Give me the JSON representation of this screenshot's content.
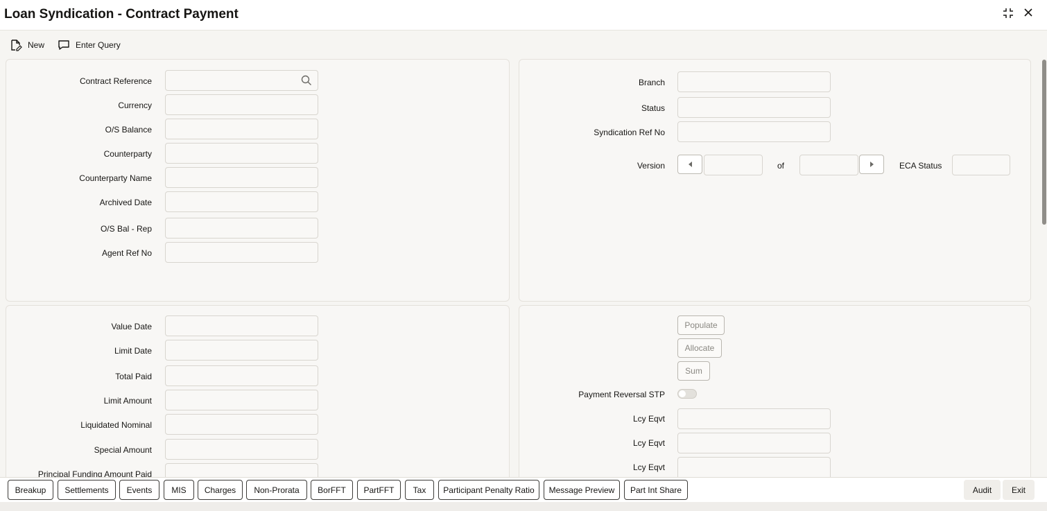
{
  "title": "Loan Syndication - Contract Payment",
  "window_icons": {
    "maximize": "expand-icon",
    "close": "close-icon"
  },
  "toolbar": {
    "new_label": "New",
    "enter_query_label": "Enter Query"
  },
  "header_left": {
    "contract_reference": "Contract Reference",
    "currency": "Currency",
    "os_balance": "O/S Balance",
    "counterparty": "Counterparty",
    "counterparty_name": "Counterparty Name",
    "archived_date": "Archived Date",
    "os_bal_rep": "O/S Bal - Rep",
    "agent_ref_no": "Agent Ref No"
  },
  "header_right": {
    "branch": "Branch",
    "status": "Status",
    "syndication_ref_no": "Syndication Ref No",
    "version": "Version",
    "of": "of",
    "eca_status": "ECA Status"
  },
  "details_left": {
    "value_date": "Value Date",
    "limit_date": "Limit Date",
    "total_paid": "Total Paid",
    "limit_amount": "Limit Amount",
    "liquidated_nominal": "Liquidated Nominal",
    "special_amount": "Special Amount",
    "principal_funding_amount_paid": "Principal Funding Amount Paid"
  },
  "details_right": {
    "populate": "Populate",
    "allocate": "Allocate",
    "sum": "Sum",
    "payment_reversal_stp": "Payment Reversal STP",
    "lcy_eqvt_1": "Lcy Eqvt",
    "lcy_eqvt_2": "Lcy Eqvt",
    "lcy_eqvt_3": "Lcy Eqvt"
  },
  "footer": {
    "breakup": "Breakup",
    "settlements": "Settlements",
    "events": "Events",
    "mis": "MIS",
    "charges": "Charges",
    "non_prorata": "Non-Prorata",
    "borfft": "BorFFT",
    "partfft": "PartFFT",
    "tax": "Tax",
    "participant_penalty_ratio": "Participant Penalty Ratio",
    "message_preview": "Message Preview",
    "part_int_share": "Part Int Share",
    "audit": "Audit",
    "exit": "Exit"
  }
}
